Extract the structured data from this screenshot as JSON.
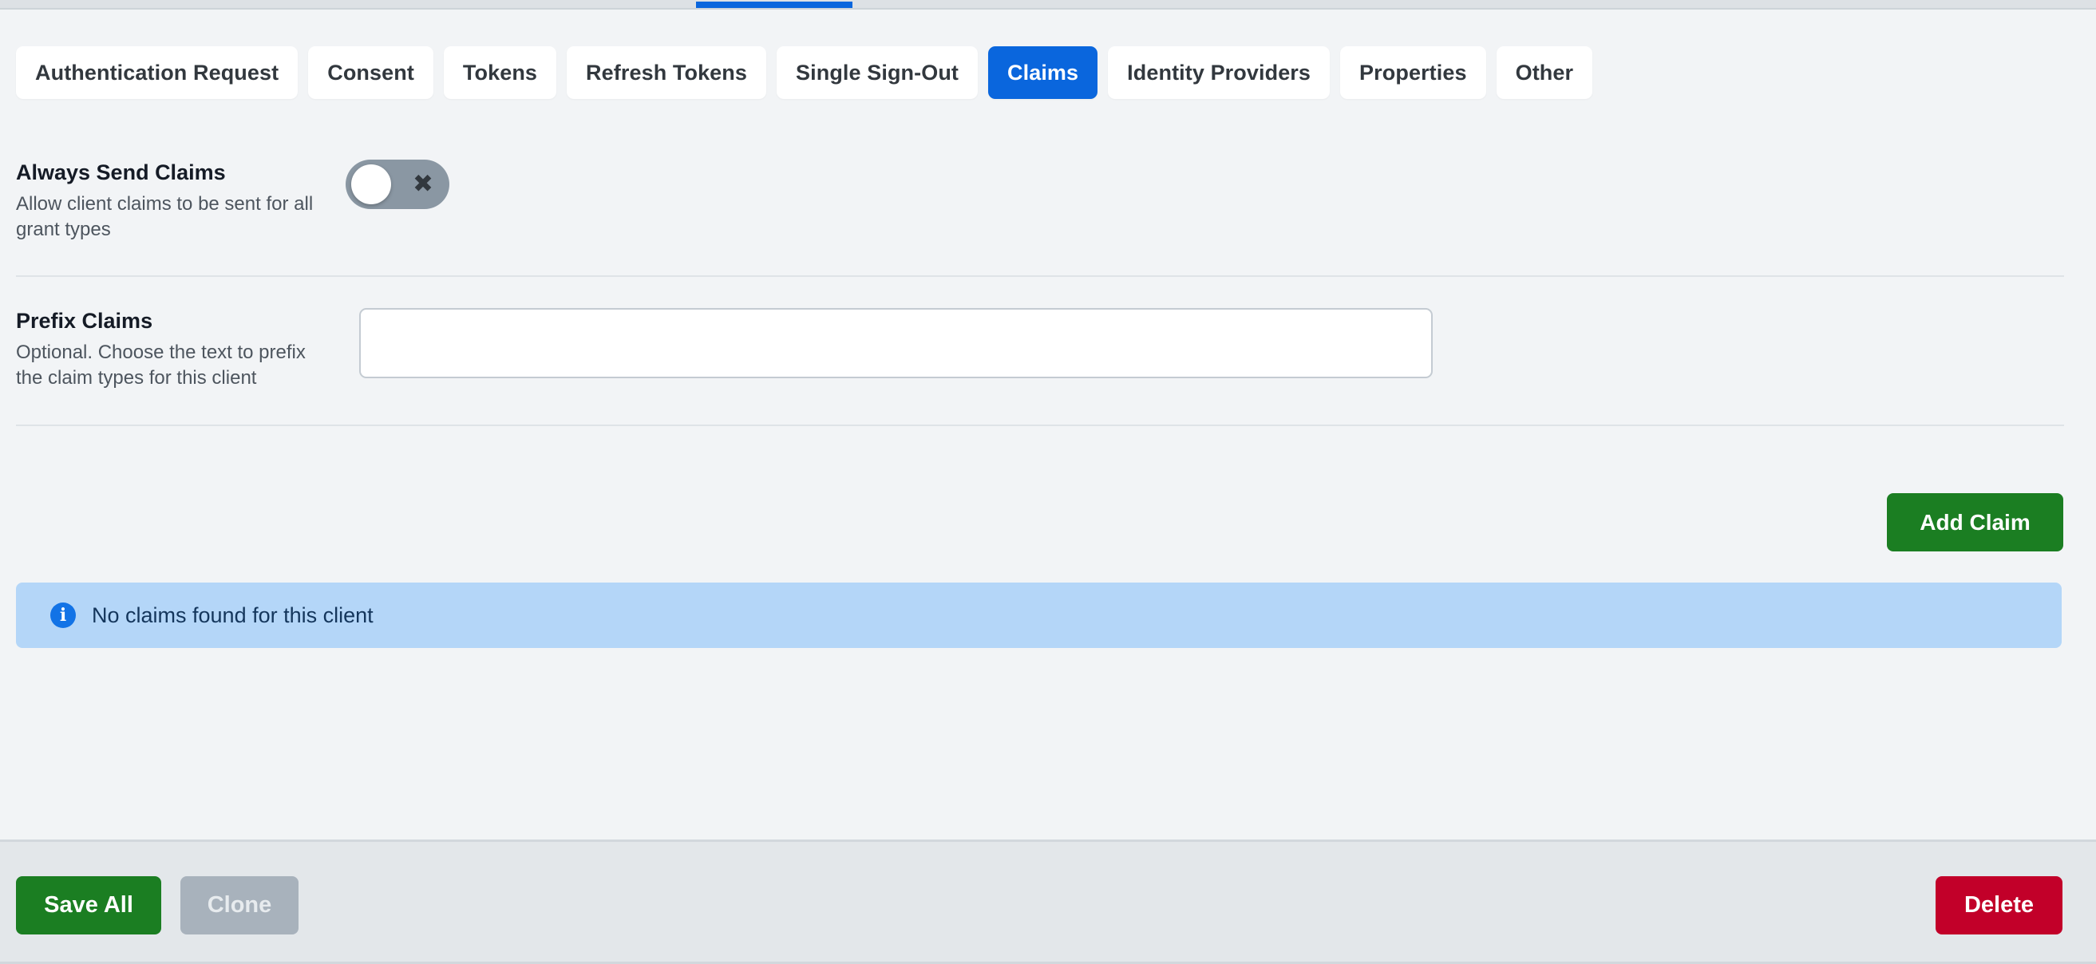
{
  "theme": {
    "page_bg": "#f2f4f6",
    "accent_blue": "#0a66dd",
    "green": "#1b7e22",
    "red": "#c20029",
    "gray": "#a8b2bc",
    "alert_bg": "#b4d6f8",
    "footer_bg": "#e3e7ea"
  },
  "top_strip": {
    "indicator_name": "active-tab-indicator"
  },
  "tabs": [
    {
      "label": "Authentication Request",
      "active": false
    },
    {
      "label": "Consent",
      "active": false
    },
    {
      "label": "Tokens",
      "active": false
    },
    {
      "label": "Refresh Tokens",
      "active": false
    },
    {
      "label": "Single Sign-Out",
      "active": false
    },
    {
      "label": "Claims",
      "active": true
    },
    {
      "label": "Identity Providers",
      "active": false
    },
    {
      "label": "Properties",
      "active": false
    },
    {
      "label": "Other",
      "active": false
    }
  ],
  "fields": {
    "always_send_claims": {
      "title": "Always Send Claims",
      "description": "Allow client claims to be sent for all grant types",
      "toggle_state": "off",
      "toggle_glyph": "✖"
    },
    "prefix_claims": {
      "title": "Prefix Claims",
      "description": "Optional. Choose the text to prefix the claim types for this client",
      "value": "",
      "placeholder": ""
    }
  },
  "actions": {
    "add_claim_label": "Add Claim"
  },
  "alert": {
    "icon": "info-icon",
    "glyph": "i",
    "message": "No claims found for this client"
  },
  "footer": {
    "save_label": "Save All",
    "clone_label": "Clone",
    "delete_label": "Delete"
  }
}
